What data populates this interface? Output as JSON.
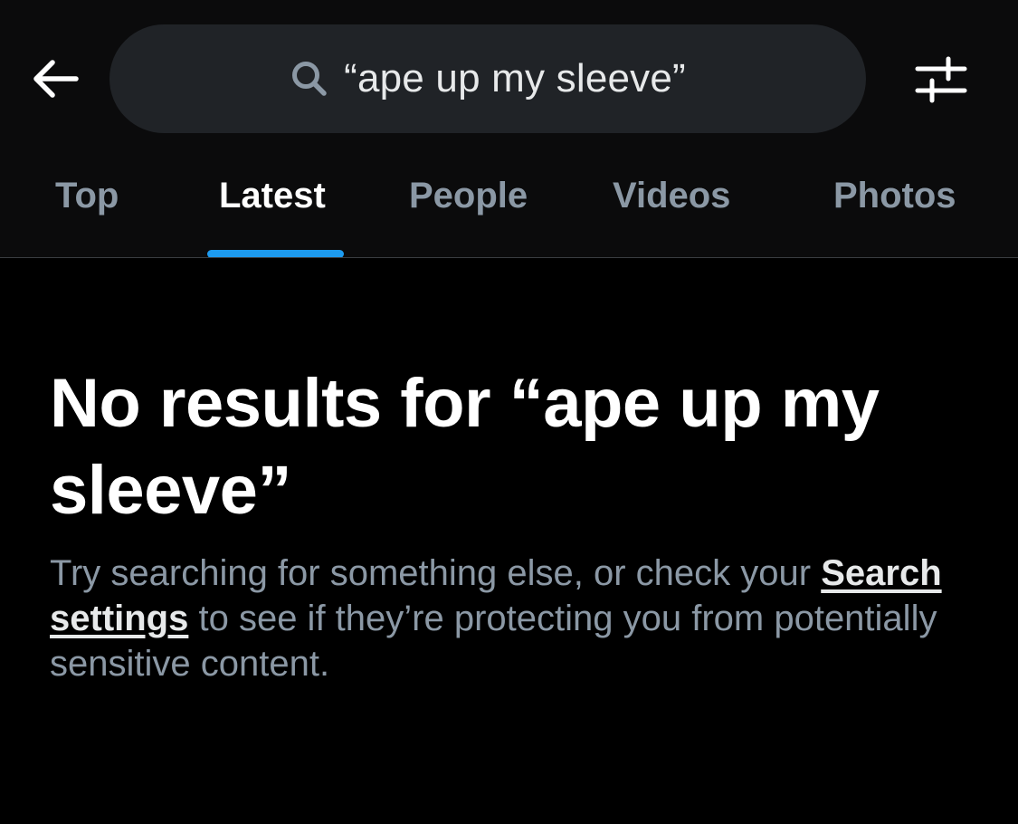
{
  "header": {
    "back_icon": "arrow-left-icon",
    "search": {
      "icon": "search-icon",
      "query": "“ape up my sleeve”"
    },
    "filter_icon": "sliders-icon"
  },
  "tabs": [
    {
      "label": "Top",
      "active": false
    },
    {
      "label": "Latest",
      "active": true
    },
    {
      "label": "People",
      "active": false
    },
    {
      "label": "Videos",
      "active": false
    },
    {
      "label": "Photos",
      "active": false
    }
  ],
  "empty_state": {
    "title": "No results for “ape up my sleeve”",
    "body_before": "Try searching for something else, or check your ",
    "link_text": "Search settings",
    "body_after": " to see if they’re protecting you from potentially sensitive content."
  },
  "colors": {
    "background": "#000000",
    "header_background": "#0b0b0c",
    "search_pill": "#202327",
    "accent": "#1d9bf0",
    "muted_text": "#8b98a5",
    "primary_text": "#ffffff"
  }
}
